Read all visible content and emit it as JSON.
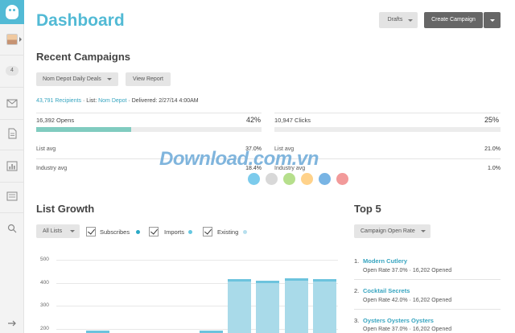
{
  "sidebar": {
    "badge_count": "4",
    "icons": [
      "logo-icon",
      "avatar",
      "mail-icon",
      "document-icon",
      "bar-chart-icon",
      "list-icon",
      "search-icon",
      "arrow-right-icon"
    ]
  },
  "header": {
    "title": "Dashboard",
    "drafts_label": "Drafts",
    "create_label": "Create Campaign"
  },
  "recent": {
    "title": "Recent Campaigns",
    "campaign_select": "Nom Depot Daily Deals",
    "view_report": "View Report",
    "recipients": "43,791 Recipients",
    "dot1": "·",
    "list_prefix": "List:",
    "list_name": "Nom Depot",
    "dot2": "·",
    "delivered_prefix": "Delivered:",
    "delivered_value": "2/27/14 4:00AM",
    "opens": {
      "label": "16,392 Opens",
      "percent": "42%",
      "fill": 0.42,
      "list_avg_label": "List avg",
      "list_avg": "37.0%",
      "industry_avg_label": "Industry avg",
      "industry_avg": "18.4%"
    },
    "clicks": {
      "label": "10,947 Clicks",
      "percent": "25%",
      "fill": 0.0,
      "list_avg_label": "List avg",
      "list_avg": "21.0%",
      "industry_avg_label": "Industry avg",
      "industry_avg": "1.0%"
    }
  },
  "growth": {
    "title": "List Growth",
    "filter": "All Lists",
    "checks": [
      {
        "label": "Subscribes",
        "color": "#2aa9c6"
      },
      {
        "label": "Imports",
        "color": "#65c7e0"
      },
      {
        "label": "Existing",
        "color": "#b7dfee"
      }
    ],
    "y_ticks": [
      "500",
      "400",
      "300",
      "200"
    ]
  },
  "chart_data": {
    "type": "bar",
    "ylim": [
      150,
      500
    ],
    "values": [
      190,
      0,
      0,
      0,
      190,
      416,
      410,
      420,
      416
    ],
    "y_ticks": [
      500,
      400,
      300,
      200
    ],
    "series": [
      {
        "values": [
          190,
          0,
          0,
          0,
          190,
          416,
          410,
          420,
          416
        ]
      }
    ]
  },
  "top5": {
    "title": "Top 5",
    "sort": "Campaign Open Rate",
    "items": [
      {
        "num": "1.",
        "title": "Modern Cutlery",
        "sub": "Open Rate 37.0% · 16,202 Opened"
      },
      {
        "num": "2.",
        "title": "Cocktail Secrets",
        "sub": "Open Rate 42.0% · 16,202 Opened"
      },
      {
        "num": "3.",
        "title": "Oysters Oysters Oysters",
        "sub": "Open Rate 37.0% · 16,202 Opened"
      }
    ]
  },
  "watermark": {
    "text": "Download.com.vn",
    "dot_colors": [
      "#7ccbec",
      "#d8d8d8",
      "#b6df8c",
      "#ffd28a",
      "#78b4e4",
      "#f29a9a"
    ]
  }
}
